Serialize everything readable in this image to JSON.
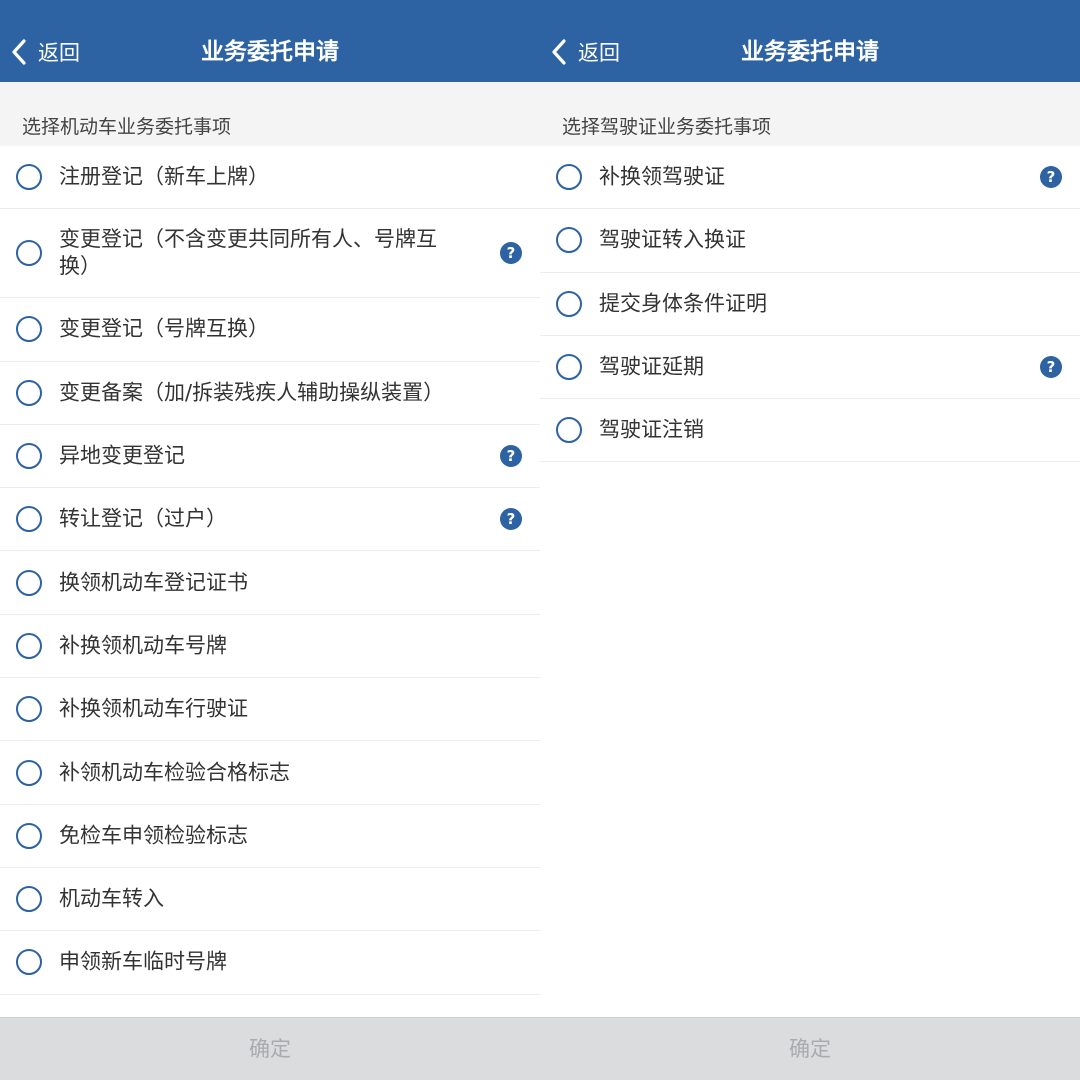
{
  "left": {
    "header": {
      "back_label": "返回",
      "title": "业务委托申请"
    },
    "section_title": "选择机动车业务委托事项",
    "items": [
      {
        "label": "注册登记（新车上牌）"
      },
      {
        "label": "变更登记（不含变更共同所有人、号牌互换）"
      },
      {
        "label": "变更登记（号牌互换）"
      },
      {
        "label": "变更备案（加/拆装残疾人辅助操纵装置）"
      },
      {
        "label": "异地变更登记"
      },
      {
        "label": "转让登记（过户）"
      },
      {
        "label": "换领机动车登记证书"
      },
      {
        "label": "补换领机动车号牌"
      },
      {
        "label": "补换领机动车行驶证"
      },
      {
        "label": "补领机动车检验合格标志"
      },
      {
        "label": "免检车申领检验标志"
      },
      {
        "label": "机动车转入"
      },
      {
        "label": "申领新车临时号牌"
      }
    ],
    "confirm_label": "确定"
  },
  "right": {
    "header": {
      "back_label": "返回",
      "title": "业务委托申请"
    },
    "section_title": "选择驾驶证业务委托事项",
    "items": [
      {
        "label": "补换领驾驶证"
      },
      {
        "label": "驾驶证转入换证"
      },
      {
        "label": "提交身体条件证明"
      },
      {
        "label": "驾驶证延期"
      },
      {
        "label": "驾驶证注销"
      }
    ],
    "confirm_label": "确定"
  },
  "icons": {
    "back": "chevron-left-icon",
    "help": "question-circle-icon",
    "radio": "radio-unchecked-icon",
    "help_glyph": "?"
  },
  "colors": {
    "header_bg": "#2d62a3",
    "accent": "#2d62a3",
    "section_bg": "#f4f4f5",
    "confirm_bg": "#dadcde",
    "confirm_text": "#a9abae"
  }
}
